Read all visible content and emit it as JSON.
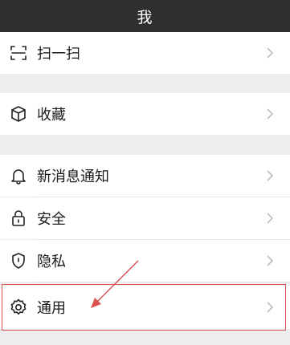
{
  "header": {
    "title": "我"
  },
  "menu": {
    "scan": {
      "label": "扫一扫",
      "icon": "scan-icon"
    },
    "favorites": {
      "label": "收藏",
      "icon": "box-icon"
    },
    "notifications": {
      "label": "新消息通知",
      "icon": "bell-icon"
    },
    "security": {
      "label": "安全",
      "icon": "lock-icon"
    },
    "privacy": {
      "label": "隐私",
      "icon": "shield-icon"
    },
    "general": {
      "label": "通用",
      "icon": "gear-icon"
    }
  },
  "annotation": {
    "color": "#d9534f",
    "target": "general"
  }
}
